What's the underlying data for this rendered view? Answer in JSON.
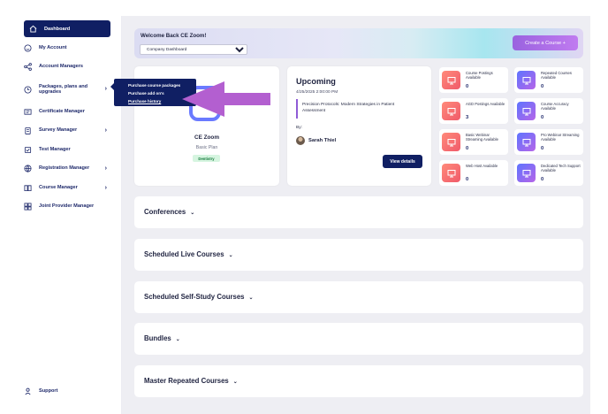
{
  "sidebar": {
    "items": [
      {
        "label": "Dashboard",
        "icon": "home-icon"
      },
      {
        "label": "My Account",
        "icon": "smiley-icon"
      },
      {
        "label": "Account Managers",
        "icon": "network-icon"
      },
      {
        "label": "Packages, plans and upgrades",
        "icon": "clock-icon"
      },
      {
        "label": "Certificate Manager",
        "icon": "certificate-icon"
      },
      {
        "label": "Survey Manager",
        "icon": "clipboard-icon"
      },
      {
        "label": "Test Manager",
        "icon": "test-icon"
      },
      {
        "label": "Registration Manager",
        "icon": "globe-icon"
      },
      {
        "label": "Course Manager",
        "icon": "book-icon"
      },
      {
        "label": "Joint Provider Manager",
        "icon": "grid-icon"
      }
    ],
    "support_label": "Support"
  },
  "popup_menu": {
    "items": [
      "Purchase course packages",
      "Purchase add on's",
      "Purchase history"
    ]
  },
  "banner": {
    "welcome": "Welcome Back CE Zoom!",
    "select_value": "Company Dashboard",
    "create_button": "Create a Course  +"
  },
  "profile": {
    "name": "CE Zoom",
    "plan": "Basic Plan",
    "tag": "Dentistry"
  },
  "upcoming": {
    "title": "Upcoming",
    "date": "4/25/2025 2:00:00 PM",
    "course": "Precision Protocols: Modern Strategies in Patient Assessment",
    "by_label": "By:",
    "presenter": "Sarah Thiel",
    "details_button": "View details"
  },
  "stats": [
    {
      "label": "Course Postings Available",
      "value": "0",
      "color": "#f0706c"
    },
    {
      "label": "Repeated Courses Available",
      "value": "0",
      "color": "#8a6cf0"
    },
    {
      "label": "AGD Postings Available",
      "value": "3",
      "color": "#f0706c"
    },
    {
      "label": "Course Accuracy Available",
      "value": "0",
      "color": "#8a6cf0"
    },
    {
      "label": "Basic Webinar Streaming Available",
      "value": "0",
      "color": "#f0706c"
    },
    {
      "label": "Pro Webinar Streaming Available",
      "value": "0",
      "color": "#8a6cf0"
    },
    {
      "label": "Web Host Available",
      "value": "0",
      "color": "#f0706c"
    },
    {
      "label": "Dedicated Tech Support Available",
      "value": "0",
      "color": "#8a6cf0"
    }
  ],
  "sections": [
    {
      "title": "Conferences"
    },
    {
      "title": "Scheduled Live Courses"
    },
    {
      "title": "Scheduled Self-Study Courses"
    },
    {
      "title": "Bundles"
    },
    {
      "title": "Master Repeated Courses"
    }
  ],
  "colors": {
    "primary_navy": "#101f63",
    "accent_purple": "#b56ad8",
    "annotation_arrow": "#b35fd0"
  }
}
